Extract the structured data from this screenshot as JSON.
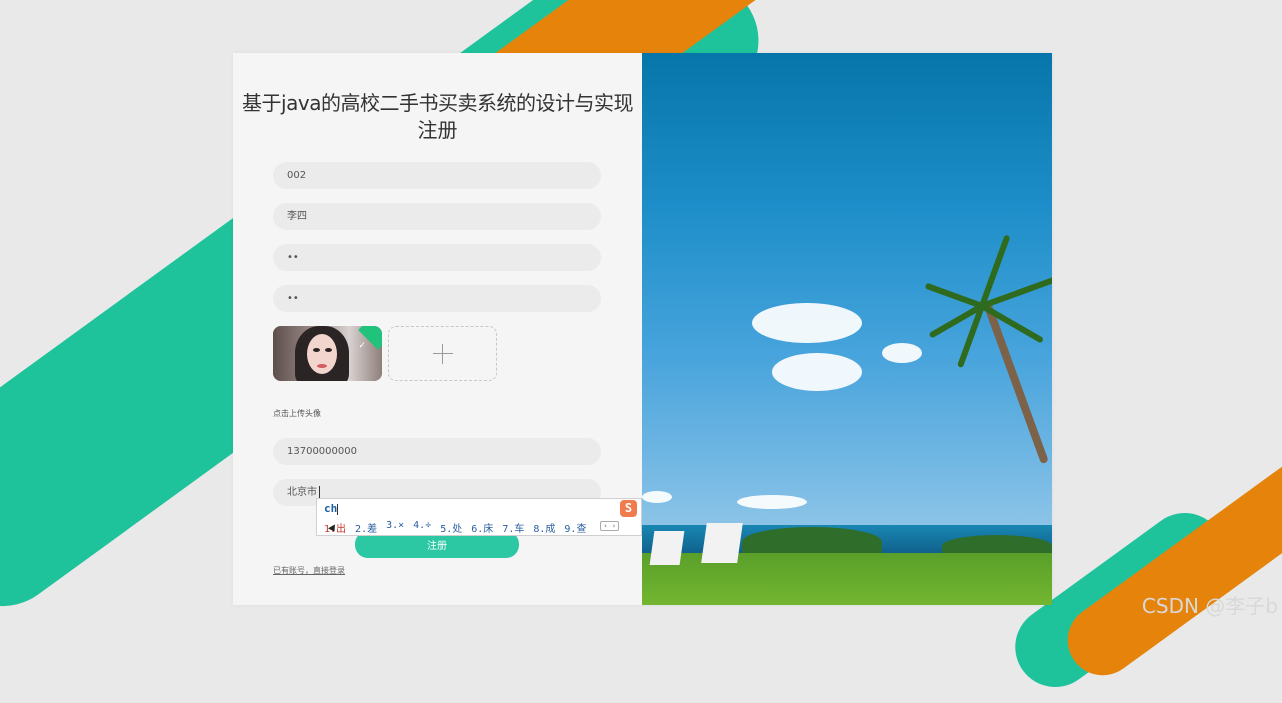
{
  "page": {
    "title_line1": "基于java的高校二手书买卖系统的设计与实现",
    "title_line2": "注册"
  },
  "form": {
    "account_value": "002",
    "name_value": "李四",
    "password_value": "••",
    "confirm_password_value": "••",
    "avatar_hint": "点击上传头像",
    "phone_value": "13700000000",
    "address_value": "北京市",
    "register_label": "注册",
    "login_link": "已有账号，直接登录"
  },
  "ime": {
    "input": "ch",
    "candidates": [
      "1.出",
      "2.差",
      "3.×",
      "4.÷",
      "5.处",
      "6.床",
      "7.车",
      "8.成",
      "9.查"
    ],
    "logo": "S",
    "arrows": "‹ ›"
  },
  "watermark": "CSDN @李子b",
  "colors": {
    "accent": "#2cc7a3",
    "stripe_teal": "#1ec39b",
    "stripe_orange": "#e6830b"
  },
  "icons": [
    "plus-icon",
    "check-icon",
    "sogou-ime-icon"
  ]
}
